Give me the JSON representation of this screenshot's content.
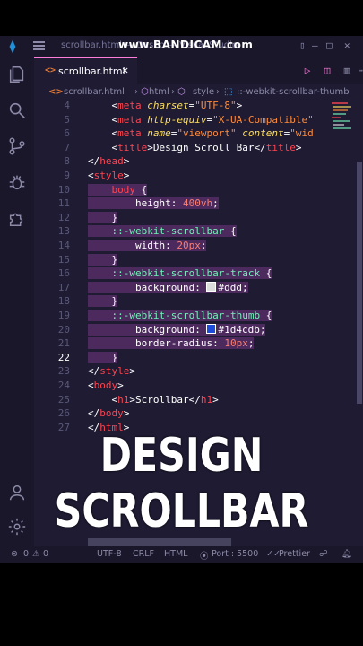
{
  "titlebar": {
    "title": "scrollbar.html — Dasbo — Visual Studio",
    "watermark": "www.BANDICAM.com"
  },
  "tabs": [
    {
      "label": "scrollbar.html",
      "close": "✕"
    }
  ],
  "breadcrumb": {
    "file": "scrollbar.html",
    "html": "html",
    "style": "style",
    "selector": "::-webkit-scrollbar-thumb"
  },
  "code_lines": [
    {
      "n": "4",
      "html": "<span class=\"t-brk\">    &lt;</span><span class=\"t-tag\">meta</span> <span class=\"t-attr\">charset</span><span class=\"t-brk\">=</span><span class=\"t-str\">\"UTF-8\"</span><span class=\"t-brk\">&gt;</span>"
    },
    {
      "n": "5",
      "html": "<span class=\"t-brk\">    &lt;</span><span class=\"t-tag\">meta</span> <span class=\"t-attr\">http-equiv</span><span class=\"t-brk\">=</span><span class=\"t-str\">\"X-UA-Compatible\"</span>"
    },
    {
      "n": "6",
      "html": "<span class=\"t-brk\">    &lt;</span><span class=\"t-tag\">meta</span> <span class=\"t-attr\">name</span><span class=\"t-brk\">=</span><span class=\"t-str\">\"viewport\"</span> <span class=\"t-attr\">content</span><span class=\"t-brk\">=</span><span class=\"t-str\">\"wid</span>"
    },
    {
      "n": "7",
      "html": "<span class=\"t-brk\">    &lt;</span><span class=\"t-tag\">title</span><span class=\"t-brk\">&gt;</span>Design Scroll Bar<span class=\"t-brk\">&lt;/</span><span class=\"t-tag\">title</span><span class=\"t-brk\">&gt;</span>"
    },
    {
      "n": "8",
      "html": "<span class=\"t-brk\">&lt;/</span><span class=\"t-tag\">head</span><span class=\"t-brk\">&gt;</span>"
    },
    {
      "n": "9",
      "html": "<span class=\"t-brk\">&lt;</span><span class=\"t-tag\">style</span><span class=\"t-brk\">&gt;</span>"
    },
    {
      "n": "10",
      "sel": true,
      "html": "<span class=\"sel\">    <span class=\"t-tag\">body</span> <span class=\"t-brk\">{</span></span>"
    },
    {
      "n": "11",
      "sel": true,
      "html": "<span class=\"sel\">        <span class=\"t-prop\">height</span>: <span class=\"t-num\">400vh</span>;</span>"
    },
    {
      "n": "12",
      "sel": true,
      "html": "<span class=\"sel\">    <span class=\"t-brk\">}</span></span>"
    },
    {
      "n": "13",
      "sel": true,
      "html": "<span class=\"sel\">    <span class=\"t-pseudo\">::-webkit-scrollbar</span> <span class=\"t-brk\">{</span></span>"
    },
    {
      "n": "14",
      "sel": true,
      "html": "<span class=\"sel\">        <span class=\"t-prop\">width</span>: <span class=\"t-num\">20px</span>;</span>"
    },
    {
      "n": "15",
      "sel": true,
      "html": "<span class=\"sel\">    <span class=\"t-brk\">}</span></span>"
    },
    {
      "n": "16",
      "sel": true,
      "html": "<span class=\"sel\">    <span class=\"t-pseudo\">::-webkit-scrollbar-track</span> <span class=\"t-brk\">{</span></span>"
    },
    {
      "n": "17",
      "sel": true,
      "html": "<span class=\"sel\">        <span class=\"t-prop\">background</span>: <span class=\"swatch\" style=\"background:#ddd\"></span>#ddd;</span>"
    },
    {
      "n": "18",
      "sel": true,
      "html": "<span class=\"sel\">    <span class=\"t-brk\">}</span></span>"
    },
    {
      "n": "19",
      "sel": true,
      "html": "<span class=\"sel\">    <span class=\"t-pseudo\">::-webkit-scrollbar-thumb</span> <span class=\"t-brk\">{</span></span>"
    },
    {
      "n": "20",
      "sel": true,
      "html": "<span class=\"sel\">        <span class=\"t-prop\">background</span>: <span class=\"swatch\" style=\"background:#1d4cdb\"></span>#1d4cdb;</span>"
    },
    {
      "n": "21",
      "sel": true,
      "html": "<span class=\"sel\">        <span class=\"t-prop\">border-radius</span>: <span class=\"t-num\">10px</span>;</span>"
    },
    {
      "n": "22",
      "sel": true,
      "active": true,
      "html": "<span class=\"sel\">    <span class=\"t-brk\">}</span></span>"
    },
    {
      "n": "23",
      "html": "<span class=\"t-brk\">&lt;/</span><span class=\"t-tag\">style</span><span class=\"t-brk\">&gt;</span>"
    },
    {
      "n": "24",
      "html": "<span class=\"t-brk\">&lt;</span><span class=\"t-tag\">body</span><span class=\"t-brk\">&gt;</span>"
    },
    {
      "n": "25",
      "html": "<span class=\"t-brk\">    &lt;</span><span class=\"t-tag\">h1</span><span class=\"t-brk\">&gt;</span>Scrollbar<span class=\"t-brk\">&lt;/</span><span class=\"t-tag\">h1</span><span class=\"t-brk\">&gt;</span>"
    },
    {
      "n": "26",
      "html": "<span class=\"t-brk\">&lt;/</span><span class=\"t-tag\">body</span><span class=\"t-brk\">&gt;</span>"
    },
    {
      "n": "27",
      "html": "<span class=\"t-brk\">&lt;/</span><span class=\"t-tag\">html</span><span class=\"t-brk\">&gt;</span>"
    }
  ],
  "statusbar": {
    "errors": "0",
    "warnings": "0",
    "encoding": "UTF-8",
    "eol": "CRLF",
    "language": "HTML",
    "port": "Port : 5500",
    "prettier": "Prettier"
  },
  "caption": {
    "line1": "DESIGN",
    "line2": "SCROLLBAR"
  },
  "colors": {
    "editor_bg": "#1e1b33",
    "accent_pink": "#ff7edb",
    "selection": "#4d2a5e"
  }
}
